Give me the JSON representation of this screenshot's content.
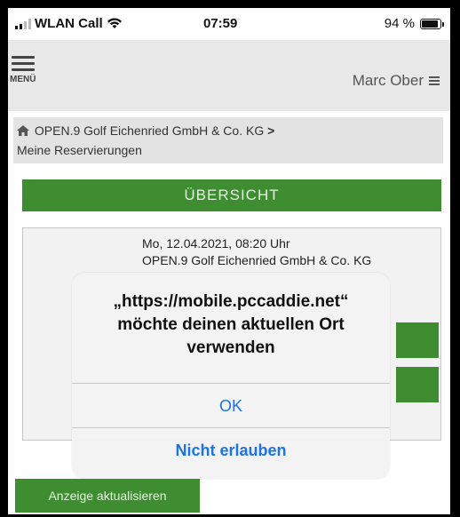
{
  "status_bar": {
    "carrier": "WLAN Call",
    "time": "07:59",
    "battery_text": "94 %",
    "battery_level": 0.94
  },
  "header": {
    "menu_label": "MENÜ",
    "user_name": "Marc Ober"
  },
  "breadcrumb": {
    "club": "OPEN.9 Golf Eichenried GmbH & Co. KG",
    "separator": ">",
    "page": "Meine Reservierungen"
  },
  "overview": {
    "label": "ÜBERSICHT"
  },
  "reservation": {
    "datetime": "Mo, 12.04.2021, 08:20 Uhr",
    "club": "OPEN.9 Golf Eichenried GmbH & Co. KG"
  },
  "refresh_button": {
    "label": "Anzeige aktualisieren"
  },
  "dialog": {
    "title": "„https://mobile.pccaddie.net“ möchte deinen aktuellen Ort verwenden",
    "ok_label": "OK",
    "deny_label": "Nicht erlauben"
  },
  "colors": {
    "accent_green": "#3e8e31",
    "dialog_button_blue": "#1a73e8"
  }
}
